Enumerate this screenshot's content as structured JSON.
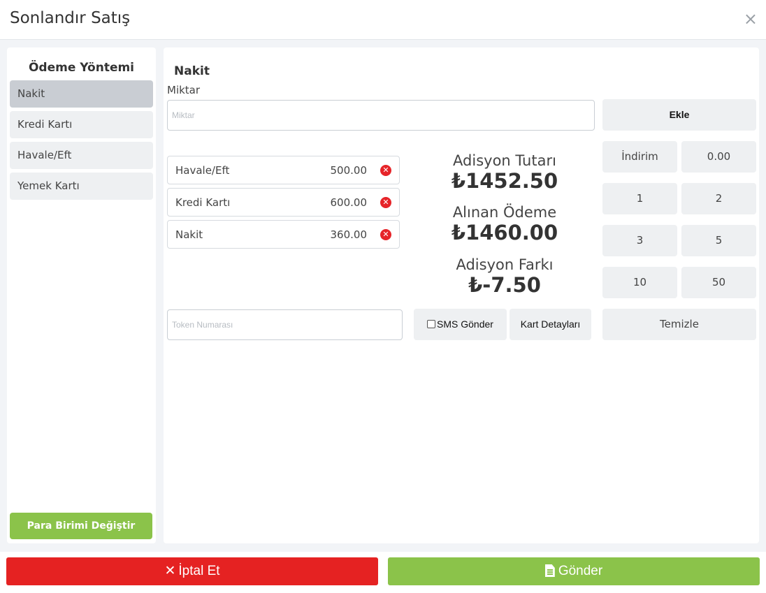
{
  "header": {
    "title": "Sonlandır Satış",
    "close": "×"
  },
  "sidebar": {
    "title": "Ödeme Yöntemi",
    "items": [
      {
        "label": "Nakit"
      },
      {
        "label": "Kredi Kartı"
      },
      {
        "label": "Havale/Eft"
      },
      {
        "label": "Yemek Kartı"
      }
    ],
    "currency_button": "Para Birimi Değiştir"
  },
  "main": {
    "section_title": "Nakit",
    "amount_label": "Miktar",
    "amount_placeholder": "Miktar",
    "add_button": "Ekle",
    "payments": [
      {
        "name": "Havale/Eft",
        "amount": "500.00"
      },
      {
        "name": "Kredi Kartı",
        "amount": "600.00"
      },
      {
        "name": "Nakit",
        "amount": "360.00"
      }
    ],
    "summary": {
      "bill_label": "Adisyon Tutarı",
      "bill_value": "₺1452.50",
      "received_label": "Alınan Ödeme",
      "received_value": "₺1460.00",
      "diff_label": "Adisyon Farkı",
      "diff_value": "₺-7.50"
    },
    "keypad": {
      "discount": "İndirim",
      "discount_value": "0.00",
      "k1": "1",
      "k2": "2",
      "k3": "3",
      "k5": "5",
      "k10": "10",
      "k50": "50",
      "clear": "Temizle"
    },
    "token_placeholder": "Token Numarası",
    "sms_label": "SMS Gönder",
    "sms_checked": false,
    "card_details": "Kart Detayları"
  },
  "footer": {
    "cancel": "İptal Et",
    "send": "Gönder"
  },
  "colors": {
    "cancel": "#e52222",
    "send": "#8bc34a",
    "delete": "#e62429"
  }
}
